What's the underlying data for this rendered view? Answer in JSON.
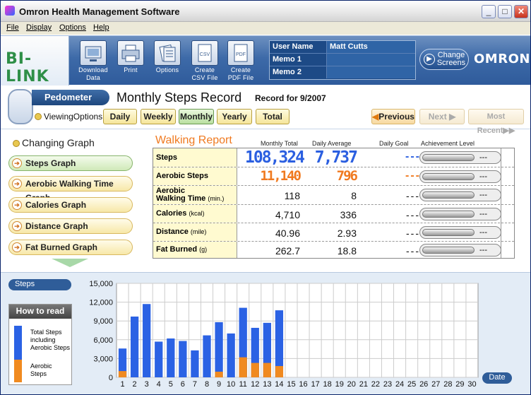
{
  "window": {
    "title": "Omron Health Management Software"
  },
  "menu": [
    "File",
    "Display",
    "Options",
    "Help"
  ],
  "toolbar": {
    "logo": "BI-LINK",
    "buttons": [
      {
        "label1": "Download",
        "label2": "Data",
        "icon": "download-icon"
      },
      {
        "label1": "Print",
        "label2": "",
        "icon": "printer-icon"
      },
      {
        "label1": "Options",
        "label2": "",
        "icon": "options-icon"
      },
      {
        "label1": "Create",
        "label2": "CSV File",
        "icon": "csv-file-icon",
        "badge": "CSV"
      },
      {
        "label1": "Create",
        "label2": "PDF File",
        "icon": "pdf-file-icon",
        "badge": "PDF"
      }
    ],
    "user_name_label": "User Name",
    "user_name": "Matt Cutts",
    "memo1_label": "Memo 1",
    "memo1": "",
    "memo2_label": "Memo 2",
    "memo2": "",
    "change_screens_1": "Change",
    "change_screens_2": "Screens",
    "brand": "OMRON"
  },
  "header": {
    "device": "Pedometer",
    "title": "Monthly Steps Record",
    "record_for": "Record for 9/2007",
    "viewing_options": "ViewingOptions",
    "views": [
      "Daily",
      "Weekly",
      "Monthly",
      "Yearly",
      "Total"
    ],
    "active_view": "Monthly",
    "previous": "Previous",
    "next": "Next",
    "most_recent": "Most Recent"
  },
  "graph_menu": {
    "title": "Changing Graph",
    "items": [
      "Steps Graph",
      "Aerobic Walking Time Graph",
      "Calories Graph",
      "Distance Graph",
      "Fat Burned Graph"
    ],
    "active": "Steps Graph"
  },
  "report": {
    "title": "Walking Report",
    "columns": [
      "Monthly Total",
      "Daily Average",
      "Daily Goal",
      "Achievement Level"
    ],
    "rows": [
      {
        "label": "Steps",
        "unit": "",
        "total": "108,324",
        "avg": "7,737",
        "goal": "---",
        "ach": "---"
      },
      {
        "label": "Aerobic Steps",
        "unit": "",
        "total": "11,140",
        "avg": "796",
        "goal": "---",
        "ach": "---"
      },
      {
        "label": "Aerobic",
        "label2": "Walking Time",
        "unit": "(min.)",
        "total": "118",
        "avg": "8",
        "goal": "---",
        "ach": "---"
      },
      {
        "label": "Calories",
        "unit": "(kcal)",
        "total": "4,710",
        "avg": "336",
        "goal": "---",
        "ach": "---"
      },
      {
        "label": "Distance",
        "unit": "(mile)",
        "total": "40.96",
        "avg": "2.93",
        "goal": "---",
        "ach": "---"
      },
      {
        "label": "Fat Burned",
        "unit": "(g)",
        "total": "262.7",
        "avg": "18.8",
        "goal": "---",
        "ach": "---"
      }
    ],
    "colors": {
      "steps": "#2b5fe0",
      "aerobic": "#f07a20"
    }
  },
  "chart_panel": {
    "y_pill": "Steps",
    "date_pill": "Date",
    "how_title": "How to read graph",
    "how_total_1": "Total Steps",
    "how_total_2": "including",
    "how_total_3": "Aerobic Steps",
    "how_aerobic_1": "Aerobic",
    "how_aerobic_2": "Steps"
  },
  "chart_data": {
    "type": "bar",
    "categories": [
      "1",
      "2",
      "3",
      "4",
      "5",
      "6",
      "7",
      "8",
      "9",
      "10",
      "11",
      "12",
      "13",
      "14",
      "15",
      "16",
      "17",
      "18",
      "19",
      "20",
      "21",
      "22",
      "23",
      "24",
      "25",
      "26",
      "27",
      "28",
      "29",
      "30"
    ],
    "series": [
      {
        "name": "Total Steps",
        "color": "#2b62e4",
        "values": [
          4600,
          9700,
          11700,
          5700,
          6200,
          5800,
          4300,
          6700,
          8800,
          7000,
          11100,
          7900,
          8700,
          10700,
          0,
          0,
          0,
          0,
          0,
          0,
          0,
          0,
          0,
          0,
          0,
          0,
          0,
          0,
          0,
          0
        ]
      },
      {
        "name": "Aerobic Steps",
        "color": "#f08a20",
        "values": [
          1000,
          0,
          0,
          0,
          0,
          0,
          0,
          0,
          900,
          0,
          3200,
          2300,
          2300,
          1800,
          0,
          0,
          0,
          0,
          0,
          0,
          0,
          0,
          0,
          0,
          0,
          0,
          0,
          0,
          0,
          0
        ]
      }
    ],
    "ylim": [
      0,
      15000
    ],
    "yticks": [
      "0",
      "3,000",
      "6,000",
      "9,000",
      "12,000",
      "15,000"
    ],
    "ytick_values": [
      0,
      3000,
      6000,
      9000,
      12000,
      15000
    ],
    "grid": true
  }
}
